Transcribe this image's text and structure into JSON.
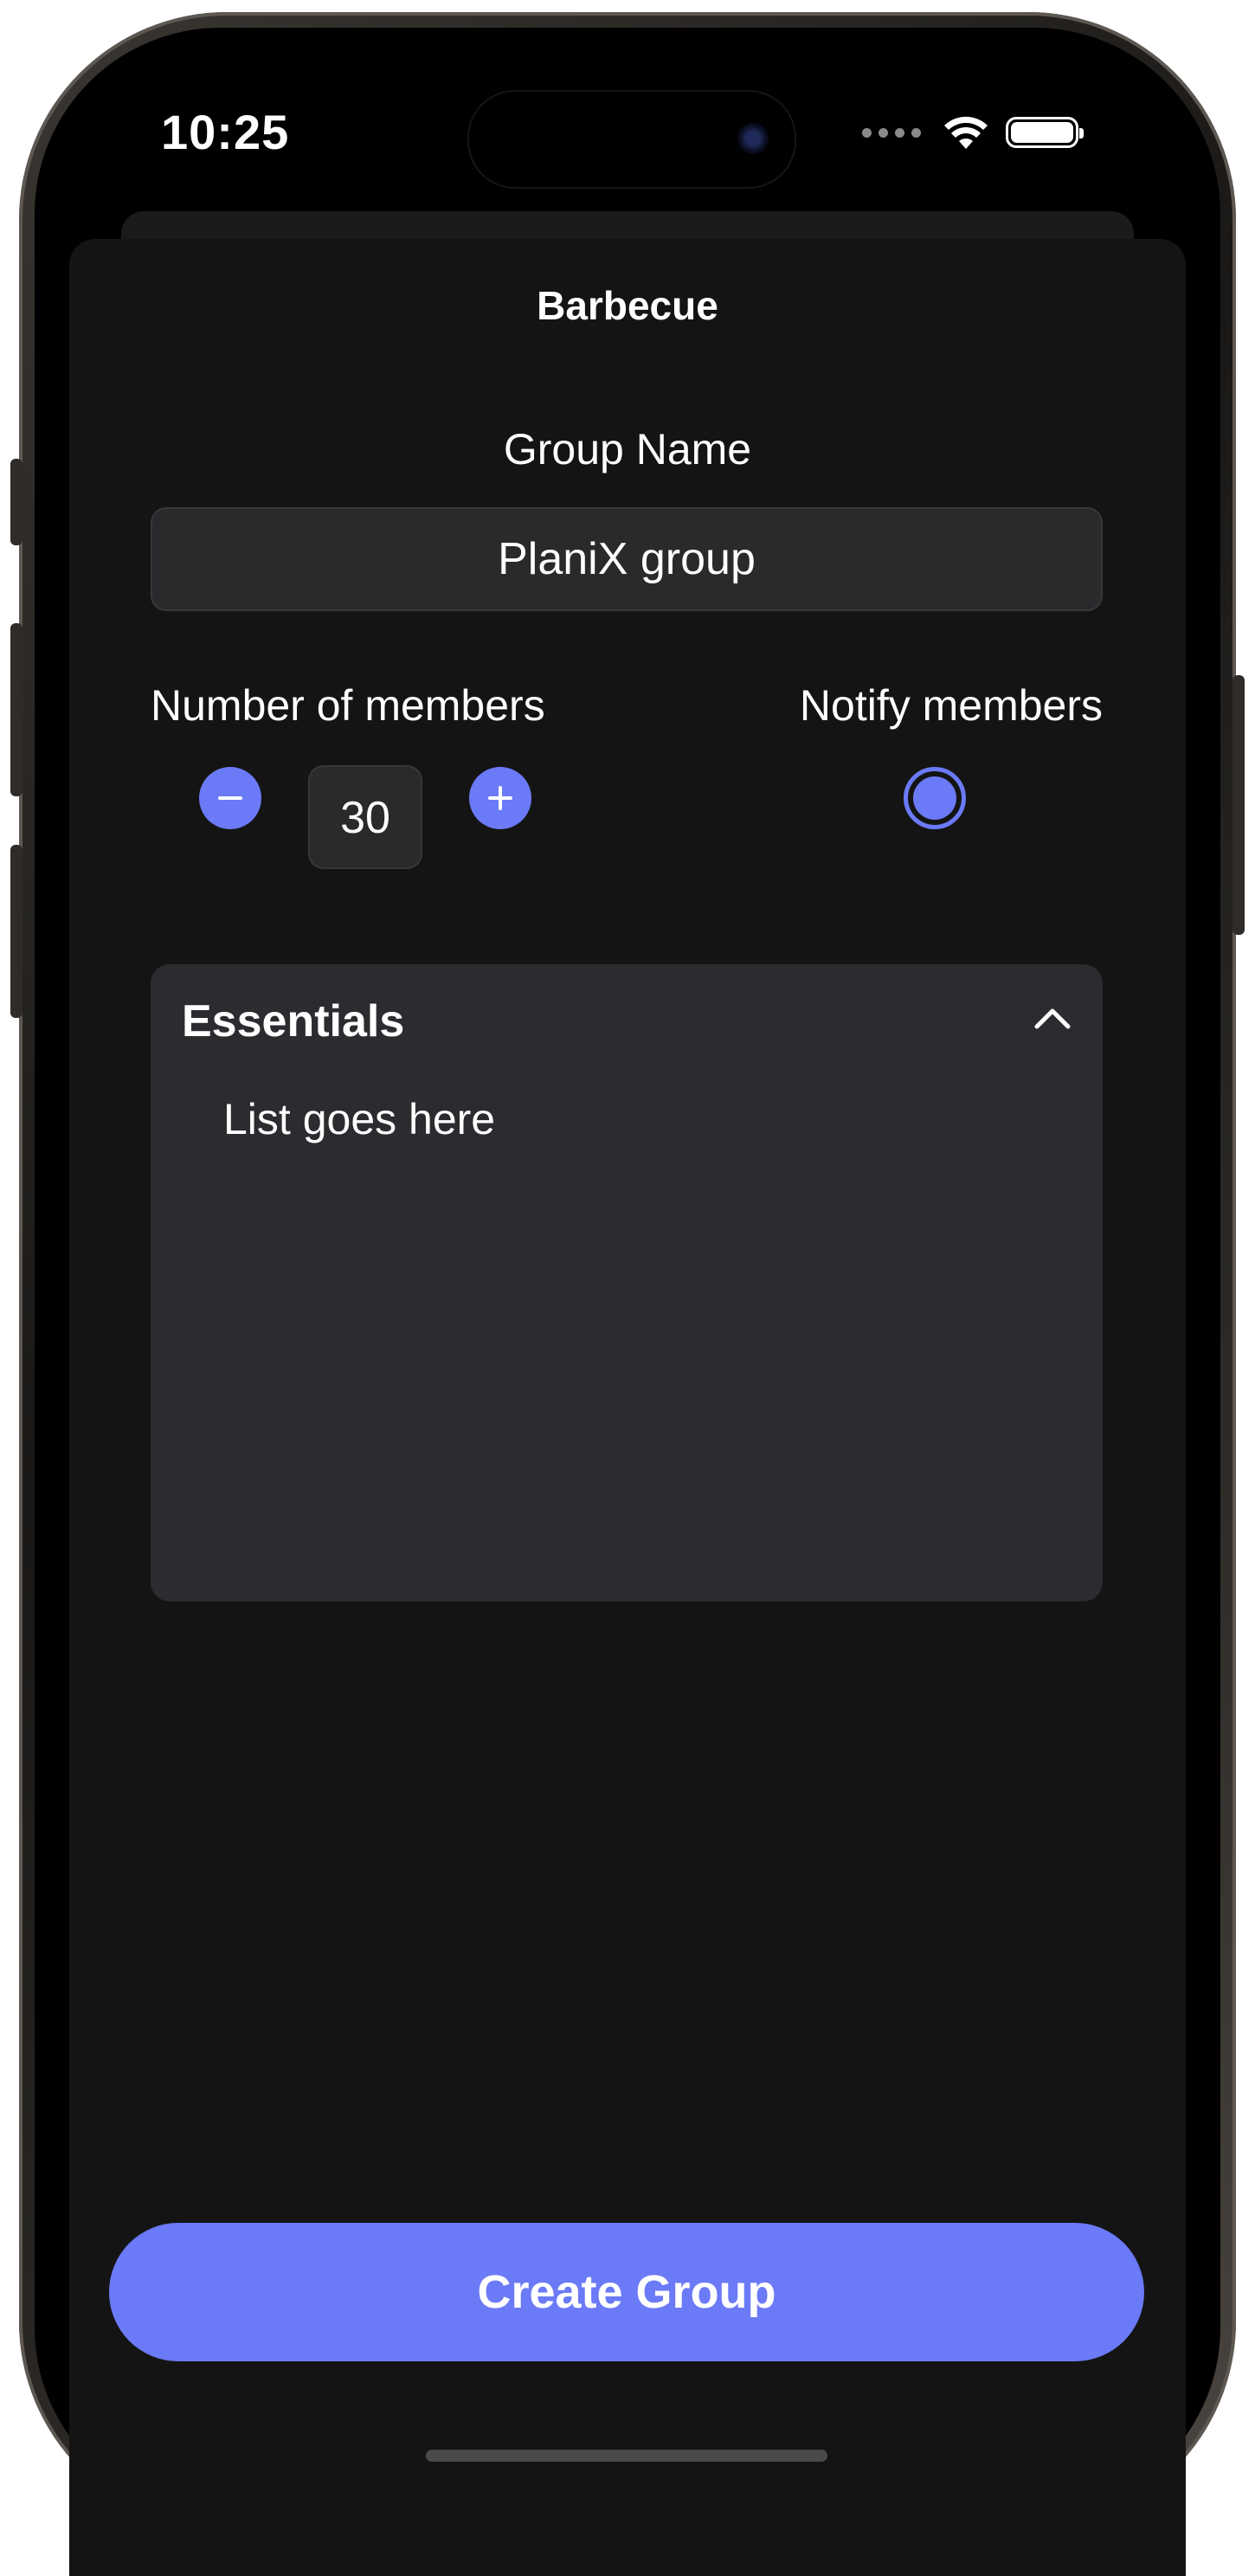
{
  "status_bar": {
    "time": "10:25",
    "icons": [
      "cellular-dots-icon",
      "wifi-icon",
      "battery-icon"
    ]
  },
  "sheet": {
    "title": "Barbecue"
  },
  "group_name": {
    "label": "Group Name",
    "value": "PlaniX group"
  },
  "members": {
    "label": "Number of members",
    "count": "30",
    "decrement_icon": "minus-icon",
    "increment_icon": "plus-icon"
  },
  "notify": {
    "label": "Notify members",
    "selected": true
  },
  "essentials": {
    "title": "Essentials",
    "body": "List goes here",
    "toggle_icon": "chevron-up-icon"
  },
  "actions": {
    "create_label": "Create Group"
  },
  "colors": {
    "accent": "#6b7af7",
    "background": "#141414",
    "surface": "#2c2c30"
  }
}
